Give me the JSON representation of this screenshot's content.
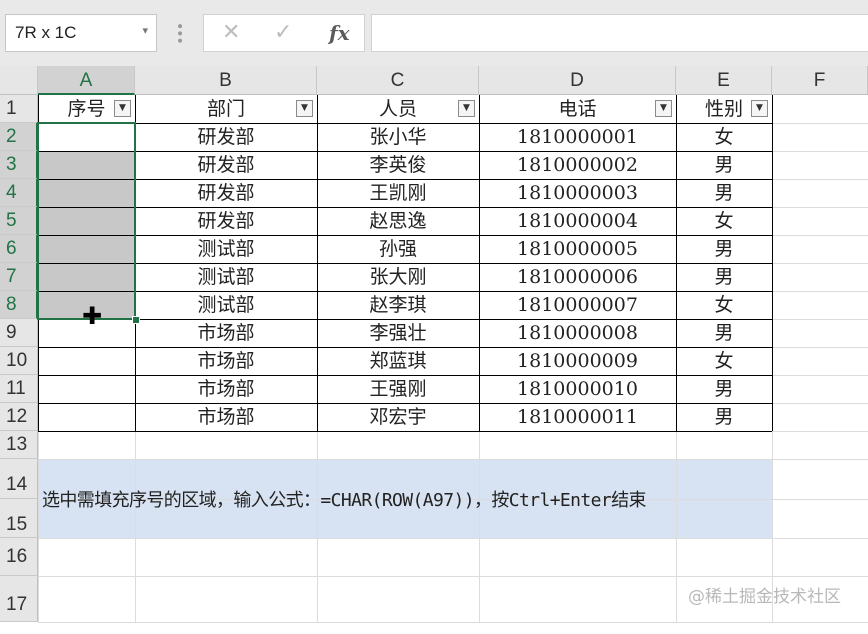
{
  "formula_bar": {
    "name_box": "7R x 1C",
    "cancel_icon": "✕",
    "enter_icon": "✓",
    "fx_label": "fx",
    "formula": ""
  },
  "columns": [
    "A",
    "B",
    "C",
    "D",
    "E",
    "F"
  ],
  "rows": [
    "1",
    "2",
    "3",
    "4",
    "5",
    "6",
    "7",
    "8",
    "9",
    "10",
    "11",
    "12",
    "13",
    "14",
    "15",
    "16",
    "17"
  ],
  "headers": [
    "序号",
    "部门",
    "人员",
    "电话",
    "性别"
  ],
  "table": [
    [
      "",
      "研发部",
      "张小华",
      "1810000001",
      "女"
    ],
    [
      "",
      "研发部",
      "李英俊",
      "1810000002",
      "男"
    ],
    [
      "",
      "研发部",
      "王凯刚",
      "1810000003",
      "男"
    ],
    [
      "",
      "研发部",
      "赵思逸",
      "1810000004",
      "女"
    ],
    [
      "",
      "测试部",
      "孙强",
      "1810000005",
      "男"
    ],
    [
      "",
      "测试部",
      "张大刚",
      "1810000006",
      "男"
    ],
    [
      "",
      "测试部",
      "赵李琪",
      "1810000007",
      "女"
    ],
    [
      "",
      "市场部",
      "李强壮",
      "1810000008",
      "男"
    ],
    [
      "",
      "市场部",
      "郑蓝琪",
      "1810000009",
      "女"
    ],
    [
      "",
      "市场部",
      "王强刚",
      "1810000010",
      "男"
    ],
    [
      "",
      "市场部",
      "邓宏宇",
      "1810000011",
      "男"
    ]
  ],
  "note": "选中需填充序号的区域，输入公式：=CHAR(ROW(A97))，按Ctrl+Enter结束",
  "watermark": "@稀土掘金技术社区",
  "selection": {
    "range": "A2:A8",
    "active_cell": "A2"
  },
  "colors": {
    "selection_accent": "#217346",
    "note_fill": "#d7e3f2",
    "selected_fill": "#c8c8c8"
  }
}
